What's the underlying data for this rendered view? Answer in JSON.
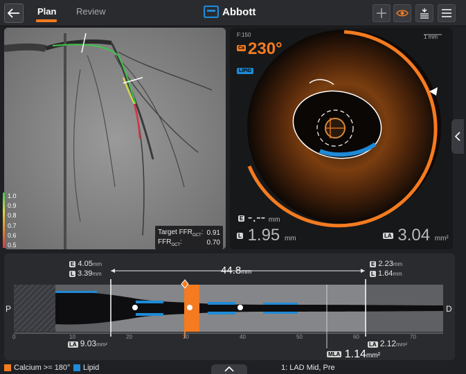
{
  "header": {
    "tabs": [
      {
        "label": "Plan",
        "active": true
      },
      {
        "label": "Review",
        "active": false
      }
    ],
    "brand": "Abbott",
    "accent": "#f47b20"
  },
  "angio": {
    "ffr_target_label": "Target FFR",
    "ffr_target_sub": "OCT",
    "ffr_target_value": "0.91",
    "ffr_label": "FFR",
    "ffr_sub": "OCT",
    "ffr_value": "0.70",
    "scale": [
      "1.0",
      "0.9",
      "0.8",
      "0.7",
      "0.6",
      "0.5"
    ]
  },
  "oct": {
    "frame": "F:150",
    "scale_label": "1 mm",
    "ca_label": "Ca",
    "angle": "230°",
    "lipid_label": "LIPID",
    "ellipse_value": "-.--",
    "ellipse_unit": "mm",
    "lumen_diam": "1.95",
    "lumen_diam_unit": "mm",
    "lumen_area": "3.04",
    "lumen_area_unit": "mm²",
    "badge_e": "E",
    "badge_l": "L",
    "badge_la": "LA"
  },
  "longitudinal": {
    "proximal": "P",
    "distal": "D",
    "left_e": "4.05",
    "left_l": "3.39",
    "right_e": "2.23",
    "right_l": "1.64",
    "unit_mm": "mm",
    "unit_mm2": "mm²",
    "length": "44.8",
    "left_la": "9.03",
    "right_la": "2.12",
    "mla_label": "MLA",
    "mla_value": "1.14",
    "ticks": [
      "0",
      "10",
      "20",
      "30",
      "40",
      "50",
      "60",
      "70"
    ]
  },
  "footer": {
    "calcium_label": "Calcium >= 180°",
    "calcium_color": "#f47b20",
    "lipid_label": "Lipid",
    "lipid_color": "#1f8ad6",
    "frame_label": "1:  LAD Mid, Pre"
  }
}
